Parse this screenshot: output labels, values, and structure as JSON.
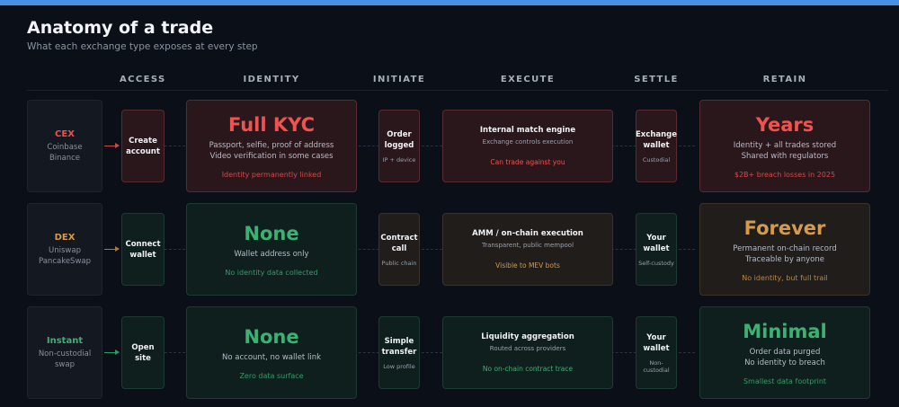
{
  "title": "Anatomy of a trade",
  "subtitle": "What each exchange type exposes at every step",
  "columns": [
    "ACCESS",
    "IDENTITY",
    "INITIATE",
    "EXECUTE",
    "SETTLE",
    "RETAIN"
  ],
  "colors": {
    "red": "#ef5350",
    "orange": "#d49a4e",
    "green": "#3bb273",
    "accent_bar": "#4a90e2"
  },
  "rows": [
    {
      "exchange": {
        "name": "CEX",
        "examples": [
          "Coinbase",
          "Binance"
        ]
      },
      "access": {
        "label": [
          "Create",
          "account"
        ]
      },
      "identity": {
        "heading": "Full KYC",
        "desc": [
          "Passport, selfie, proof of address",
          "Video verification in some cases"
        ],
        "footer": "Identity permanently linked"
      },
      "initiate": {
        "label": [
          "Order",
          "logged"
        ],
        "footer": "IP + device"
      },
      "execute": {
        "label": "Internal match engine",
        "desc": "Exchange controls execution",
        "footer": "Can trade against you"
      },
      "settle": {
        "label": [
          "Exchange",
          "wallet"
        ],
        "footer": "Custodial"
      },
      "retain": {
        "heading": "Years",
        "desc": [
          "Identity + all trades stored",
          "Shared with regulators"
        ],
        "footer": "$2B+ breach losses in 2025"
      }
    },
    {
      "exchange": {
        "name": "DEX",
        "examples": [
          "Uniswap",
          "PancakeSwap"
        ]
      },
      "access": {
        "label": [
          "Connect",
          "wallet"
        ]
      },
      "identity": {
        "heading": "None",
        "desc": [
          "Wallet address only"
        ],
        "footer": "No identity data collected"
      },
      "initiate": {
        "label": [
          "Contract",
          "call"
        ],
        "footer": "Public chain"
      },
      "execute": {
        "label": "AMM / on-chain execution",
        "desc": "Transparent, public mempool",
        "footer": "Visible to MEV bots"
      },
      "settle": {
        "label": [
          "Your",
          "wallet"
        ],
        "footer": "Self-custody"
      },
      "retain": {
        "heading": "Forever",
        "desc": [
          "Permanent on-chain record",
          "Traceable by anyone"
        ],
        "footer": "No identity, but full trail"
      }
    },
    {
      "exchange": {
        "name": "Instant",
        "examples": [
          "Non-custodial",
          "swap"
        ]
      },
      "access": {
        "label": [
          "Open",
          "site"
        ]
      },
      "identity": {
        "heading": "None",
        "desc": [
          "No account, no wallet link"
        ],
        "footer": "Zero data surface"
      },
      "initiate": {
        "label": [
          "Simple",
          "transfer"
        ],
        "footer": "Low profile"
      },
      "execute": {
        "label": "Liquidity aggregation",
        "desc": "Routed across providers",
        "footer": "No on-chain contract trace"
      },
      "settle": {
        "label": [
          "Your",
          "wallet"
        ],
        "footer": "Non-custodial"
      },
      "retain": {
        "heading": "Minimal",
        "desc": [
          "Order data purged",
          "No identity to breach"
        ],
        "footer": "Smallest data footprint"
      }
    }
  ]
}
